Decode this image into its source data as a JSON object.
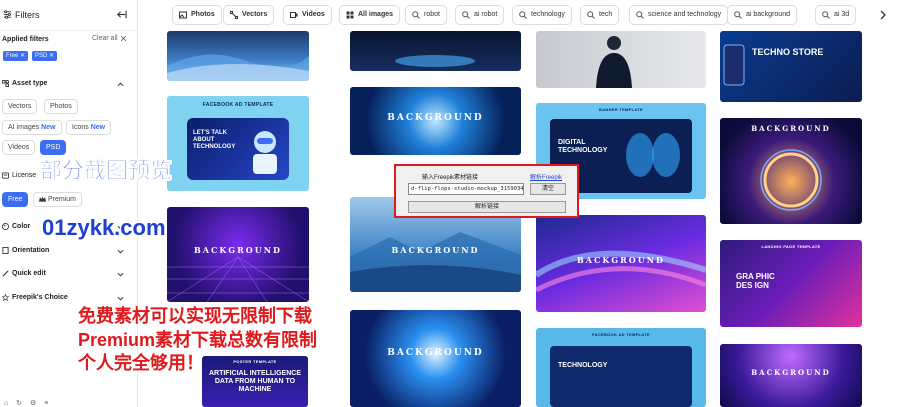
{
  "sidebar": {
    "title": "Filters",
    "applied_filters_label": "Applied filters",
    "clear_all_label": "Clear all",
    "applied": [
      "Free",
      "PSD"
    ],
    "asset_type": {
      "title": "Asset type",
      "vectors": "Vectors",
      "photos": "Photos",
      "ai_images": "AI images",
      "icons": "Icons",
      "new_badge": "New",
      "videos": "Videos",
      "psd": "PSD"
    },
    "license": {
      "title": "License",
      "free": "Free",
      "premium": "Premium"
    },
    "sections": {
      "color": "Color",
      "orientation": "Orientation",
      "quick_edit": "Quick edit",
      "freepik_choice": "Freepik's Choice"
    }
  },
  "overlay": {
    "preview_text": "部分截图预览",
    "site_text": "01zykk.com",
    "promo_line1": "免费素材可以实现无限制下载",
    "promo_line2": "Premium素材下载总数有限制",
    "promo_line3": "个人完全够用！"
  },
  "topbar": {
    "tabs": [
      "Photos",
      "Vectors",
      "Videos",
      "All images",
      "robot",
      "ai robot",
      "technology",
      "tech",
      "science and technology",
      "ai background",
      "ai 3d"
    ]
  },
  "gallery": {
    "card_texts": {
      "facebook_ad": "FACEBOOK AD TEMPLATE",
      "lets_talk": "LET'S TALK ABOUT TECHNOLOGY",
      "techno_store": "TECHNO STORE",
      "background": "BACKGROUND",
      "digital_technology": "DIGITAL TECHNOLOGY",
      "banner_template": "BANNER TEMPLATE",
      "landing_page": "LANDING PAGE TEMPLATE",
      "graphic_design": "GRA PHIC DES IGN",
      "poster_template": "POSTER TEMPLATE",
      "artificial_intelligence": "ARTIFICIAL INTELLIGENCE DATA FROM HUMAN TO MACHINE",
      "technology": "TECHNOLOGY",
      "facebook_ad2": "FACEBOOK AD TEMPLATE"
    }
  },
  "dialog": {
    "label": "输入Freepik素材链接",
    "link": "解析Freepik",
    "input_value": "d-flip-flops-studio-mockup_31590344.htm",
    "clear_button": "清空",
    "parse_button": "解析链接"
  },
  "colors": {
    "accent": "#3b6ef3",
    "promo_red": "#e0191c",
    "site_blue": "#1f3fcf"
  }
}
